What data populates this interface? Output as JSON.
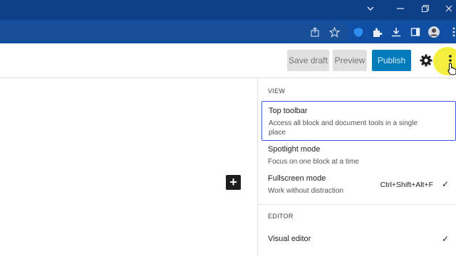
{
  "browser": {
    "window_controls": [
      "chevron-down-icon",
      "minimize-icon",
      "restore-icon",
      "close-icon"
    ],
    "toolbar_icons": [
      "share-icon",
      "star-icon",
      "shield-icon",
      "extensions-icon",
      "download-icon",
      "sidepanel-icon",
      "profile-icon",
      "browser-menu-icon"
    ]
  },
  "header": {
    "save_draft": "Save draft",
    "preview": "Preview",
    "publish": "Publish"
  },
  "menu": {
    "view_label": "VIEW",
    "items": [
      {
        "title": "Top toolbar",
        "desc": "Access all block and document tools in a single place",
        "active": true
      },
      {
        "title": "Spotlight mode",
        "desc": "Focus on one block at a time"
      },
      {
        "title": "Fullscreen mode",
        "desc": "Work without distraction",
        "shortcut": "Ctrl+Shift+Alt+F",
        "check": "✓"
      }
    ],
    "editor_label": "EDITOR",
    "editor_items": [
      {
        "title": "Visual editor",
        "check": "✓"
      }
    ]
  },
  "canvas": {
    "add_block": "+"
  },
  "colors": {
    "titlebar": "#0c3f86",
    "publish": "#007cba",
    "highlight": "#f2ec1c",
    "focus": "#3858e9"
  }
}
